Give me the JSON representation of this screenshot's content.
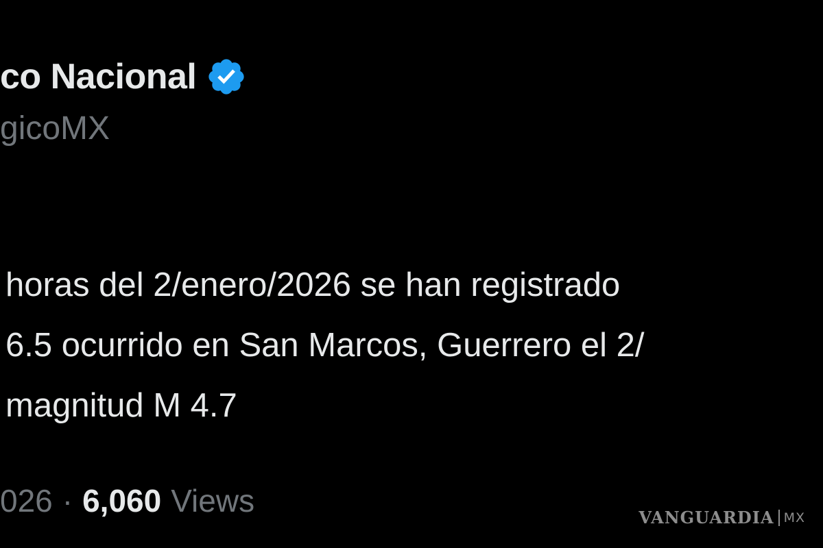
{
  "author": {
    "name": "co Nacional",
    "handle": "gicoMX",
    "verified": true,
    "badge_color": "#1d9bf0"
  },
  "tweet": {
    "lines": [
      "horas del 2/enero/2026 se han registrado",
      "6.5 ocurrido en San Marcos, Guerrero el 2/",
      "magnitud M 4.7"
    ]
  },
  "meta": {
    "date_fragment": "026",
    "separator": "·",
    "views_count": "6,060",
    "views_label": "Views"
  },
  "watermark": {
    "brand": "VANGUARDIA",
    "suffix": "MX"
  },
  "colors": {
    "background": "#000000",
    "primary_text": "#e7e9ea",
    "secondary_text": "#71767b",
    "verified_badge": "#1d9bf0"
  }
}
